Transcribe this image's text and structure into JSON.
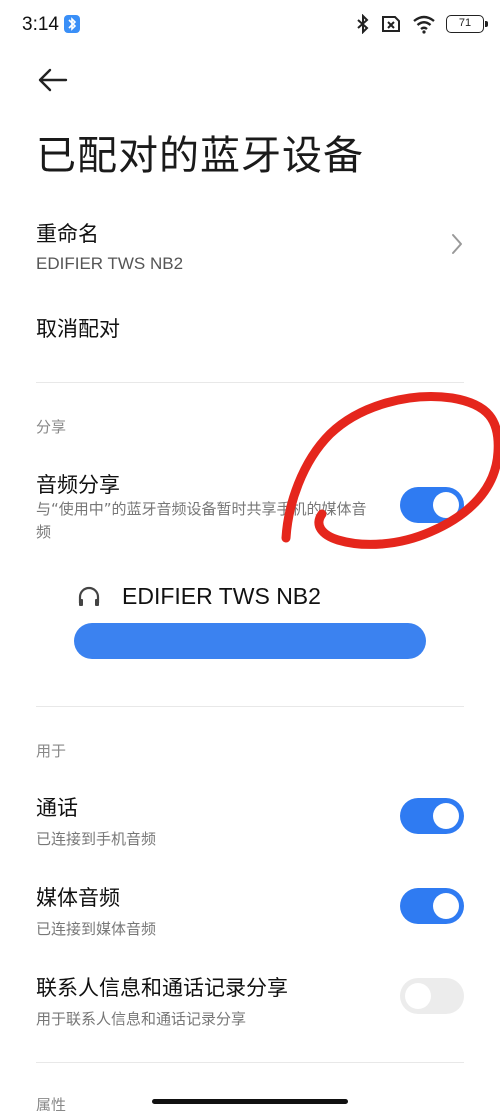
{
  "status_bar": {
    "time": "3:14",
    "battery": "71"
  },
  "header": {
    "title": "已配对的蓝牙设备"
  },
  "rename": {
    "title": "重命名",
    "device": "EDIFIER TWS NB2"
  },
  "unpair": {
    "label": "取消配对"
  },
  "share_section": {
    "label": "分享",
    "audio_share": {
      "title": "音频分享",
      "description": "与“使用中”的蓝牙音频设备暂时共享手机的媒体音频",
      "enabled": true
    },
    "device": {
      "name": "EDIFIER TWS NB2"
    }
  },
  "use_section": {
    "label": "用于",
    "items": [
      {
        "title": "通话",
        "subtitle": "已连接到手机音频",
        "enabled": true
      },
      {
        "title": "媒体音频",
        "subtitle": "已连接到媒体音频",
        "enabled": true
      },
      {
        "title": "联系人信息和通话记录分享",
        "subtitle": "用于联系人信息和通话记录分享",
        "enabled": false
      }
    ]
  },
  "properties_section": {
    "label": "属性"
  },
  "colors": {
    "accent": "#2f7bf2",
    "annotation": "#e5261c"
  }
}
